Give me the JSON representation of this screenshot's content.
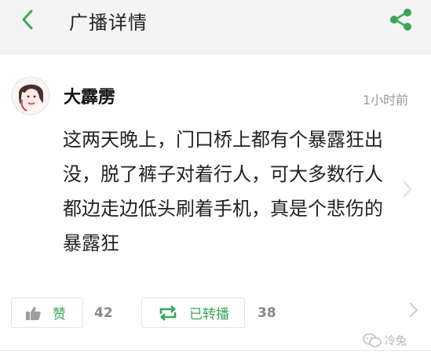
{
  "header": {
    "title": "广播详情",
    "back_icon": "chevron-left-icon",
    "share_icon": "share-icon",
    "accent_color": "#3aa757"
  },
  "post": {
    "author": "大霹雳",
    "timestamp": "1小时前",
    "lines": [
      "这两天晚上，门口桥上都有个暴露狂出",
      "没，脱了裤子对着行人，可大多数行人",
      "都边走边低头刷着手机，真是个悲伤的",
      "暴露狂"
    ]
  },
  "actions": {
    "like_label": "赞",
    "like_count": "42",
    "repost_label": "已转播",
    "repost_count": "38"
  },
  "watermark": {
    "text": "冷兔"
  }
}
